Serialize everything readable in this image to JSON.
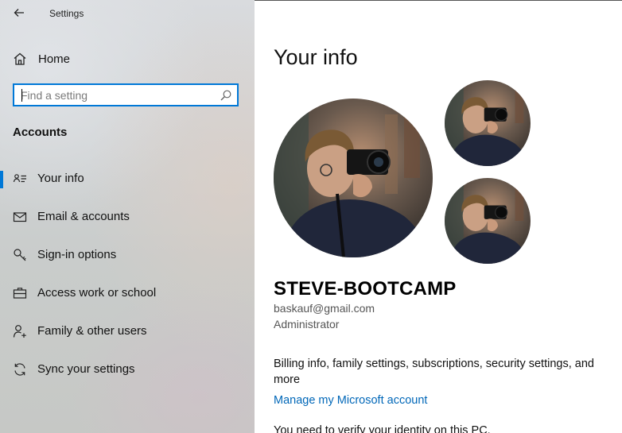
{
  "window": {
    "title": "Settings"
  },
  "sidebar": {
    "home_label": "Home",
    "search": {
      "placeholder": "Find a setting",
      "value": ""
    },
    "section_heading": "Accounts",
    "items": [
      {
        "label": "Your info",
        "icon": "person-card-icon",
        "selected": true
      },
      {
        "label": "Email & accounts",
        "icon": "mail-icon",
        "selected": false
      },
      {
        "label": "Sign-in options",
        "icon": "key-icon",
        "selected": false
      },
      {
        "label": "Access work or school",
        "icon": "briefcase-icon",
        "selected": false
      },
      {
        "label": "Family & other users",
        "icon": "person-add-icon",
        "selected": false
      },
      {
        "label": "Sync your settings",
        "icon": "sync-icon",
        "selected": false
      }
    ]
  },
  "main": {
    "title": "Your info",
    "user": {
      "name": "STEVE-BOOTCAMP",
      "email": "baskauf@gmail.com",
      "role": "Administrator"
    },
    "billing_text": "Billing info, family settings, subscriptions, security settings, and more",
    "manage_link": "Manage my Microsoft account",
    "verify_text": "You need to verify your identity on this PC."
  },
  "colors": {
    "accent": "#0078d7",
    "link": "#0067b8"
  }
}
